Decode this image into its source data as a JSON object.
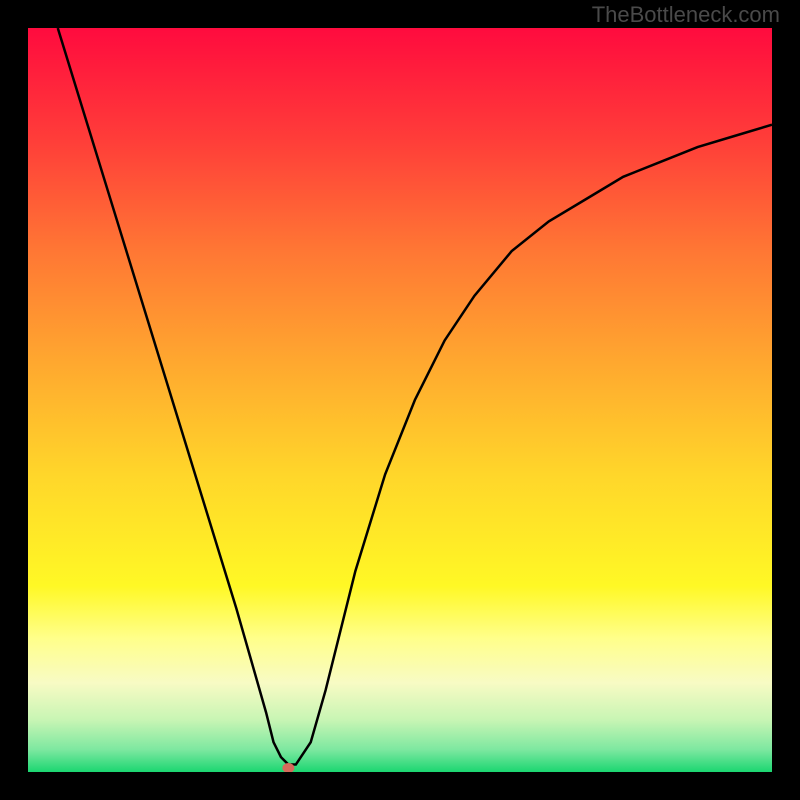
{
  "watermark": "TheBottleneck.com",
  "chart_data": {
    "type": "line",
    "title": "",
    "xlabel": "",
    "ylabel": "",
    "xlim": [
      0,
      100
    ],
    "ylim": [
      0,
      100
    ],
    "series": [
      {
        "name": "bottleneck-curve",
        "x": [
          4,
          8,
          12,
          16,
          20,
          24,
          28,
          30,
          32,
          33,
          34,
          35,
          36,
          38,
          40,
          44,
          48,
          52,
          56,
          60,
          65,
          70,
          75,
          80,
          85,
          90,
          95,
          100
        ],
        "values": [
          100,
          87,
          74,
          61,
          48,
          35,
          22,
          15,
          8,
          4,
          2,
          1,
          1,
          4,
          11,
          27,
          40,
          50,
          58,
          64,
          70,
          74,
          77,
          80,
          82,
          84,
          85.5,
          87
        ]
      }
    ],
    "minimum_point": {
      "x": 35,
      "y": 0
    },
    "gradient_stops": [
      {
        "offset": 0,
        "color": "#ff0b3e"
      },
      {
        "offset": 15,
        "color": "#ff3d39"
      },
      {
        "offset": 30,
        "color": "#ff7734"
      },
      {
        "offset": 45,
        "color": "#ffa82f"
      },
      {
        "offset": 60,
        "color": "#ffd62a"
      },
      {
        "offset": 75,
        "color": "#fff825"
      },
      {
        "offset": 82,
        "color": "#ffff8a"
      },
      {
        "offset": 88,
        "color": "#f8fbc4"
      },
      {
        "offset": 93,
        "color": "#c8f5b4"
      },
      {
        "offset": 97,
        "color": "#7de8a0"
      },
      {
        "offset": 100,
        "color": "#1bd671"
      }
    ]
  }
}
